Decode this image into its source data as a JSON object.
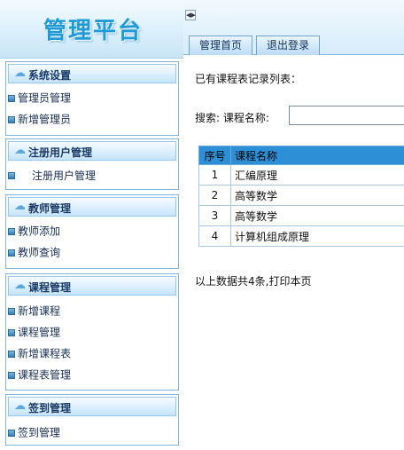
{
  "logo": {
    "text": "管理平台"
  },
  "sidebar": {
    "sections": [
      {
        "title": "系统设置",
        "items": [
          "管理员管理",
          "新增管理员"
        ]
      },
      {
        "title": "注册用户管理",
        "items": [
          "注册用户管理"
        ]
      },
      {
        "title": "教师管理",
        "items": [
          "教师添加",
          "教师查询"
        ]
      },
      {
        "title": "课程管理",
        "items": [
          "新增课程",
          "课程管理",
          "新增课程表",
          "课程表管理"
        ]
      },
      {
        "title": "签到管理",
        "items": [
          "签到管理"
        ]
      }
    ]
  },
  "tabs": [
    "管理首页",
    "退出登录"
  ],
  "main": {
    "heading": "已有课程表记录列表：",
    "search": {
      "label": "搜索:  课程名称:",
      "value": ""
    },
    "table": {
      "headers": [
        "序号",
        "课程名称"
      ],
      "rows": [
        [
          "1",
          "汇编原理"
        ],
        [
          "2",
          "高等数学"
        ],
        [
          "3",
          "高等数学"
        ],
        [
          "4",
          "计算机组成原理"
        ]
      ]
    },
    "summary": "以上数据共4条,打印本页"
  },
  "colors": {
    "accent": "#2d8fd6",
    "logo": "#1e9bd7",
    "header_bg": "#d7ecfa"
  }
}
